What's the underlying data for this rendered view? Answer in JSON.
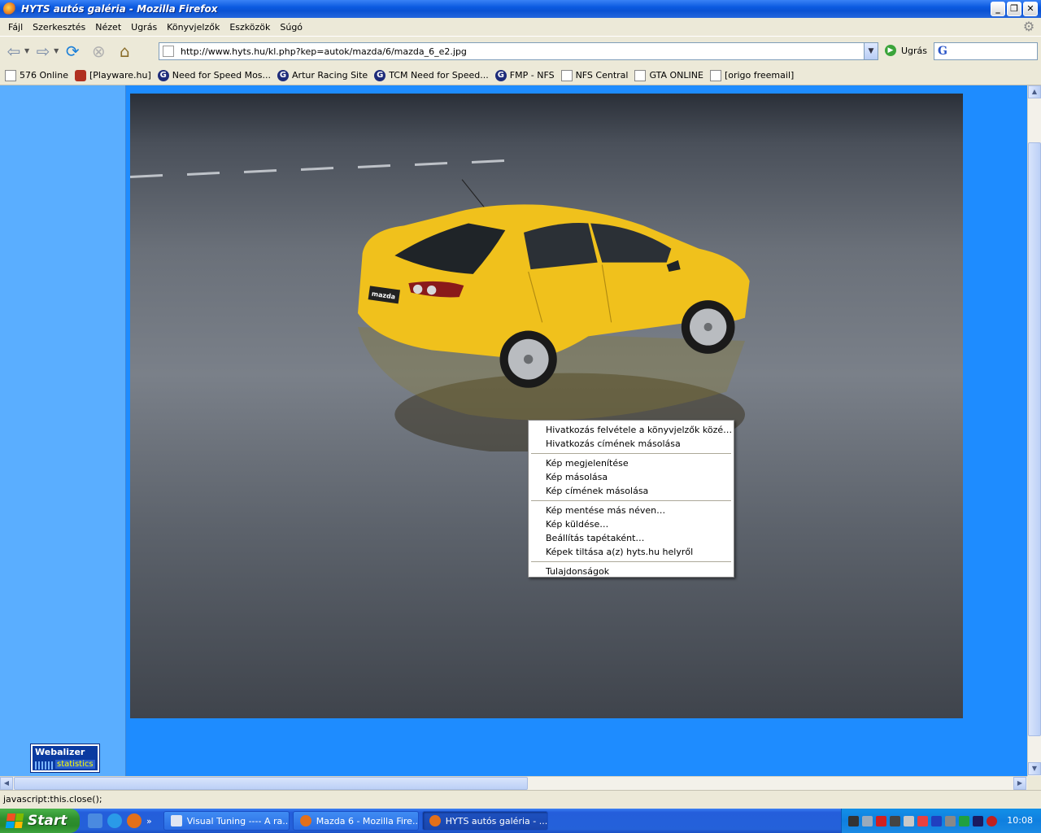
{
  "window": {
    "title": "HYTS autós galéria - Mozilla Firefox"
  },
  "menubar": {
    "items": [
      "Fájl",
      "Szerkesztés",
      "Nézet",
      "Ugrás",
      "Könyvjelzők",
      "Eszközök",
      "Súgó"
    ]
  },
  "navbar": {
    "url": "http://www.hyts.hu/kl.php?kep=autok/mazda/6/mazda_6_e2.jpg",
    "go_label": "Ugrás",
    "search_logo": "G"
  },
  "bookmarks": [
    {
      "label": "576 Online",
      "icon": "page-icon"
    },
    {
      "label": "[Playware.hu]",
      "icon": "playware-icon"
    },
    {
      "label": "Need for Speed Mos...",
      "icon": "g-icon"
    },
    {
      "label": "Artur Racing Site",
      "icon": "g-icon"
    },
    {
      "label": "TCM Need for Speed...",
      "icon": "g-icon"
    },
    {
      "label": "FMP - NFS",
      "icon": "g-icon"
    },
    {
      "label": "NFS Central",
      "icon": "page-icon"
    },
    {
      "label": "GTA ONLINE",
      "icon": "page-icon"
    },
    {
      "label": "[origo freemail]",
      "icon": "page-icon"
    }
  ],
  "content": {
    "webalizer_title": "Webalizer",
    "webalizer_sub": "statistics"
  },
  "context_menu": {
    "groups": [
      [
        "Hivatkozás felvétele a könyvjelzők közé…",
        "Hivatkozás címének másolása"
      ],
      [
        "Kép megjelenítése",
        "Kép másolása",
        "Kép címének másolása"
      ],
      [
        "Kép mentése más néven…",
        "Kép küldése…",
        "Beállítás tapétaként…",
        "Képek tiltása a(z) hyts.hu helyről"
      ],
      [
        "Tulajdonságok"
      ]
    ]
  },
  "statusbar": {
    "text": "javascript:this.close();"
  },
  "taskbar": {
    "start_label": "Start",
    "tasks": [
      {
        "label": "Visual Tuning ---- A ra...",
        "active": false
      },
      {
        "label": "Mazda 6 - Mozilla Fire...",
        "active": false
      },
      {
        "label": "HYTS autós galéria - ...",
        "active": true
      }
    ],
    "clock": "10:08"
  },
  "colors": {
    "content_bg": "#1e8cff",
    "left_pane": "#5aaeff",
    "car_yellow": "#f2c21f"
  }
}
